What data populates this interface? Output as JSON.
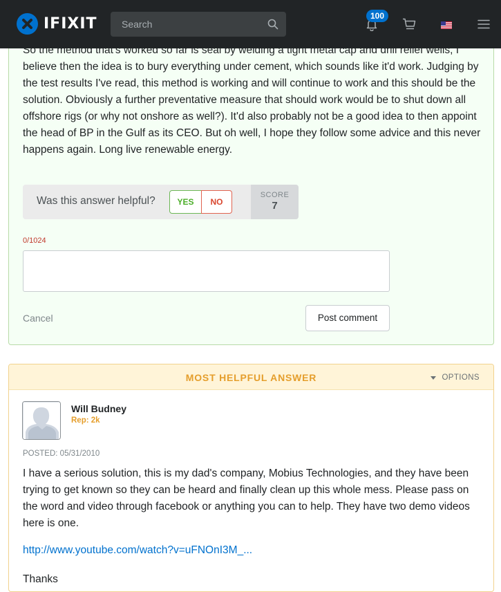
{
  "header": {
    "logo_text": "IFIXIT",
    "search_placeholder": "Search",
    "notification_count": "100",
    "icons": [
      "search-icon",
      "bell-icon",
      "cart-icon",
      "us-flag-icon",
      "hamburger-menu-icon"
    ],
    "brand_color": "#0071ce"
  },
  "answer1": {
    "text": "So the method that's worked so far is seal by welding a tight metal cap and drill relief wells, I believe then the idea is to bury everything under cement, which sounds like it'd work. Judging by the test results I've read, this method is working and will continue to work and this should be the solution. Obviously a further preventative measure that should work would be to shut down all offshore rigs (or why not onshore as well?). It'd also probably not be a good idea to then appoint the head of BP in the Gulf as its CEO. But oh well, I hope they follow some advice and this never happens again. Long live renewable energy.",
    "helpful_question": "Was this answer helpful?",
    "yes_label": "YES",
    "no_label": "NO",
    "score_label": "SCORE",
    "score_value": "7",
    "char_counter": "0/1024",
    "cancel_label": "Cancel",
    "post_comment_label": "Post comment"
  },
  "answer2": {
    "section_title": "MOST HELPFUL ANSWER",
    "options_label": "OPTIONS",
    "author_name": "Will Budney",
    "author_rep": "Rep: 2k",
    "posted": "POSTED: 05/31/2010",
    "text": "I have a serious solution, this is my dad's company, Mobius Technologies, and they have been trying to get known so they can be heard and finally clean up this whole mess. Please pass on the word and video through facebook or anything you can to help. They have two demo videos here is one.",
    "link_text": "http://www.youtube.com/watch?v=uFNOnI3M_...",
    "thanks": "Thanks"
  }
}
